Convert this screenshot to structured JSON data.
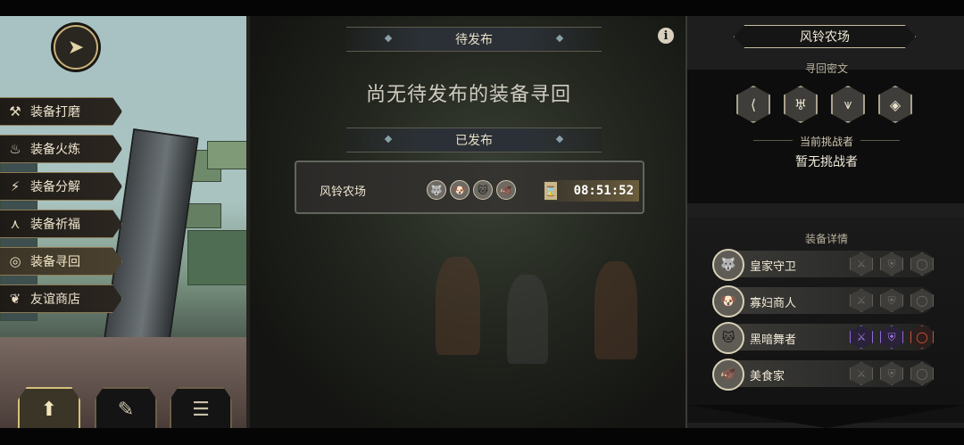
{
  "back_button": {
    "icon": "back-arrow-icon"
  },
  "menu": {
    "items": [
      {
        "label": "装备打磨",
        "icon": "hammer-icon"
      },
      {
        "label": "装备火炼",
        "icon": "fire-icon"
      },
      {
        "label": "装备分解",
        "icon": "decompose-icon"
      },
      {
        "label": "装备祈福",
        "icon": "pray-icon"
      },
      {
        "label": "装备寻回",
        "icon": "recall-icon",
        "active": true
      },
      {
        "label": "友谊商店",
        "icon": "fox-icon"
      }
    ]
  },
  "bottom_buttons": [
    {
      "icon": "upload-icon",
      "active": true
    },
    {
      "icon": "feather-icon"
    },
    {
      "icon": "list-icon"
    }
  ],
  "center": {
    "pending_header": "待发布",
    "empty_message": "尚无待发布的装备寻回",
    "published_header": "已发布",
    "info_icon": "i",
    "entry": {
      "name": "风铃农场",
      "members": [
        "🐺",
        "🐶",
        "🐱",
        "🐗"
      ],
      "timer": "08:51:52"
    }
  },
  "right": {
    "title": "风铃农场",
    "recall_label": "寻回密文",
    "runes": [
      "⟨",
      "♅",
      "⩛",
      "◈"
    ],
    "challenger_label": "当前挑战者",
    "challenger_value": "暂无挑战者",
    "gear_label": "装备详情",
    "gear_rows": [
      {
        "name": "皇家守卫",
        "avatar": "🐺",
        "slots": [
          "weapon",
          "armor",
          "ring"
        ],
        "lit": [
          false,
          false,
          false
        ]
      },
      {
        "name": "寡妇商人",
        "avatar": "🐶",
        "slots": [
          "weapon",
          "armor",
          "ring"
        ],
        "lit": [
          false,
          false,
          false
        ]
      },
      {
        "name": "黑暗舞者",
        "avatar": "🐱",
        "slots": [
          "weapon",
          "armor",
          "ring"
        ],
        "lit": [
          true,
          true,
          true
        ]
      },
      {
        "name": "美食家",
        "avatar": "🐗",
        "slots": [
          "weapon",
          "armor",
          "ring"
        ],
        "lit": [
          false,
          false,
          false
        ]
      }
    ]
  },
  "colors": {
    "accent_gold": "#c8b27a",
    "rare_purple": "#8e6ad6",
    "ring_red": "#ef5a3a"
  }
}
